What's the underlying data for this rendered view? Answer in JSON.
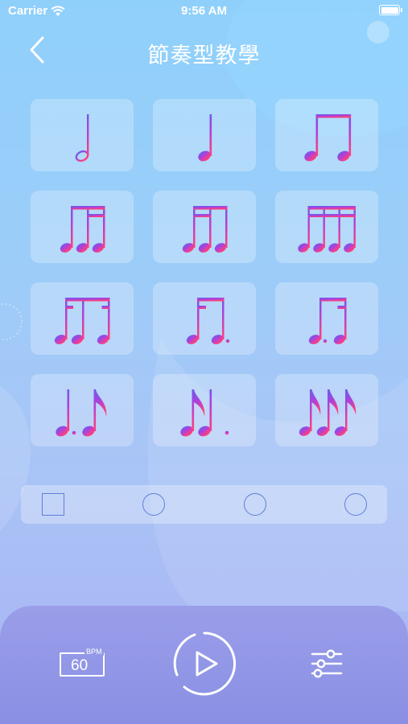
{
  "status_bar": {
    "carrier": "Carrier",
    "time": "9:56 AM",
    "wifi_icon": "wifi-icon",
    "battery_icon": "battery-icon"
  },
  "nav": {
    "title": "節奏型教學",
    "back_icon": "chevron-left-icon"
  },
  "rhythm_patterns": [
    {
      "id": "half-note",
      "icon": "half-note-icon"
    },
    {
      "id": "quarter-note",
      "icon": "quarter-note-icon"
    },
    {
      "id": "two-eighths",
      "icon": "two-eighth-notes-icon"
    },
    {
      "id": "eighth-two-sixteenths",
      "icon": "eighth-two-sixteenths-icon"
    },
    {
      "id": "two-sixteenths-eighth",
      "icon": "two-sixteenths-eighth-icon"
    },
    {
      "id": "four-sixteenths",
      "icon": "four-sixteenth-notes-icon"
    },
    {
      "id": "sixteenth-eighth-sixteenth",
      "icon": "sixteenth-eighth-sixteenth-icon"
    },
    {
      "id": "sixteenth-dotted-eighth",
      "icon": "sixteenth-dotted-eighth-icon"
    },
    {
      "id": "dotted-eighth-sixteenth",
      "icon": "dotted-eighth-sixteenth-icon"
    },
    {
      "id": "dotted-quarter-eighth",
      "icon": "dotted-quarter-eighth-icon"
    },
    {
      "id": "eighth-dotted-quarter",
      "icon": "eighth-dotted-quarter-icon"
    },
    {
      "id": "three-eighths",
      "icon": "three-eighth-notes-icon"
    }
  ],
  "beats": [
    {
      "shape": "square"
    },
    {
      "shape": "circle"
    },
    {
      "shape": "circle"
    },
    {
      "shape": "circle"
    }
  ],
  "controls": {
    "bpm_unit": "BPM",
    "bpm_value": "60",
    "play_icon": "play-icon",
    "settings_icon": "sliders-icon"
  },
  "colors": {
    "note_gradient_top": "#5a63f2",
    "note_gradient_mid": "#b040d8",
    "note_gradient_bottom": "#ff3f7a",
    "beat_outline": "#5e7fd6",
    "panel": "#9096e6"
  }
}
